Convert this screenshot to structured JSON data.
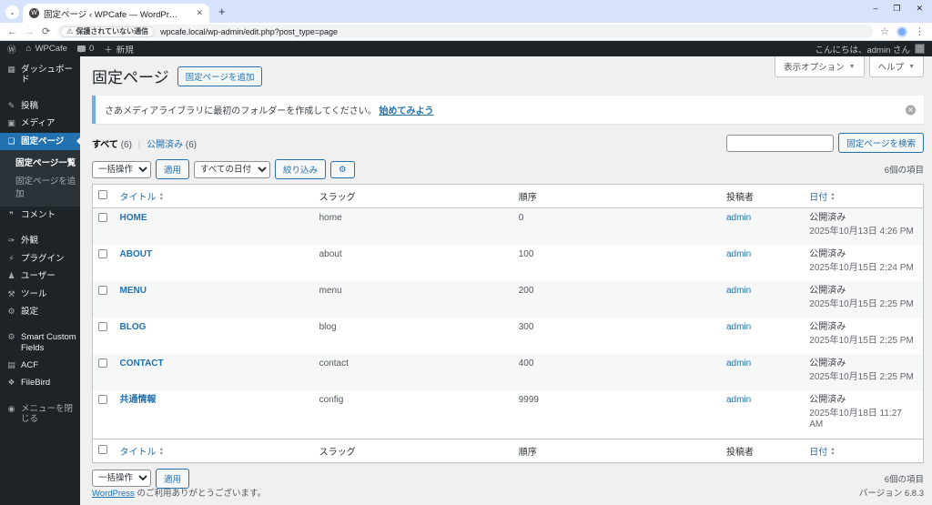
{
  "colors": {
    "accent": "#2271b1",
    "sidebar_bg": "#1d2327",
    "notice_border": "#72aee6",
    "titlebar_bg": "#d7e3fc"
  },
  "browser": {
    "tab_title": "固定ページ ‹ WPCafe — WordPr…",
    "favicon_letter": "W",
    "tab_close": "✕",
    "new_tab": "+",
    "minimize": "–",
    "restore": "❐",
    "close_window": "✕",
    "back": "←",
    "forward": "→",
    "reload": "⟳",
    "security_label": "保護されていない通信",
    "warn_icon": "⚠",
    "url": "wpcafe.local/wp-admin/edit.php?post_type=page",
    "bookmark_star": "☆",
    "menu_dots": "⋮",
    "chevron": "⌄"
  },
  "admin_bar": {
    "wp_logo": "Ⓦ",
    "home_icon": "⌂",
    "site_name": "WPCafe",
    "comment_count": "0",
    "plus": "＋",
    "new_label": "新規",
    "greeting": "こんにちは、admin さん"
  },
  "sidebar": {
    "items": [
      {
        "label": "ダッシュボード",
        "icon": "▦"
      },
      {
        "label": "投稿",
        "icon": "✎"
      },
      {
        "label": "メディア",
        "icon": "▣"
      },
      {
        "label": "固定ページ",
        "icon": "❏"
      },
      {
        "label": "コメント",
        "icon": "❞"
      },
      {
        "label": "外観",
        "icon": "✑"
      },
      {
        "label": "プラグイン",
        "icon": "⚡"
      },
      {
        "label": "ユーザー",
        "icon": "♟"
      },
      {
        "label": "ツール",
        "icon": "⚒"
      },
      {
        "label": "設定",
        "icon": "⚙"
      },
      {
        "label": "Smart Custom Fields",
        "icon": "⚙"
      },
      {
        "label": "ACF",
        "icon": "▤"
      },
      {
        "label": "FileBird",
        "icon": "❖"
      },
      {
        "label": "メニューを閉じる",
        "icon": "◉"
      }
    ],
    "submenu": [
      {
        "label": "固定ページ一覧"
      },
      {
        "label": "固定ページを追加"
      }
    ]
  },
  "header": {
    "title": "固定ページ",
    "add_button": "固定ページを追加",
    "screen_options": "表示オプション",
    "help": "ヘルプ",
    "caret": "▼"
  },
  "notice": {
    "text": "さあメディアライブラリに最初のフォルダーを作成してください。",
    "link": "始めてみよう",
    "dismiss": "✕"
  },
  "filters": {
    "all": "すべて",
    "all_count": "(6)",
    "published": "公開済み",
    "published_count": "(6)",
    "search_button": "固定ページを検索"
  },
  "bulk": {
    "bulk_action": "一括操作",
    "apply": "適用",
    "all_dates": "すべての日付",
    "filter": "絞り込み",
    "gear": "⚙",
    "items_count": "6個の項目"
  },
  "table": {
    "headers": {
      "title": "タイトル",
      "slug": "スラッグ",
      "order": "順序",
      "author": "投稿者",
      "date": "日付"
    },
    "rows": [
      {
        "title": "HOME",
        "slug": "home",
        "order": "0",
        "author": "admin",
        "status": "公開済み",
        "date": "2025年10月13日 4:26 PM"
      },
      {
        "title": "ABOUT",
        "slug": "about",
        "order": "100",
        "author": "admin",
        "status": "公開済み",
        "date": "2025年10月15日 2:24 PM"
      },
      {
        "title": "MENU",
        "slug": "menu",
        "order": "200",
        "author": "admin",
        "status": "公開済み",
        "date": "2025年10月15日 2:25 PM"
      },
      {
        "title": "BLOG",
        "slug": "blog",
        "order": "300",
        "author": "admin",
        "status": "公開済み",
        "date": "2025年10月15日 2:25 PM"
      },
      {
        "title": "CONTACT",
        "slug": "contact",
        "order": "400",
        "author": "admin",
        "status": "公開済み",
        "date": "2025年10月15日 2:25 PM"
      },
      {
        "title": "共通情報",
        "slug": "config",
        "order": "9999",
        "author": "admin",
        "status": "公開済み",
        "date": "2025年10月18日 11:27 AM"
      }
    ]
  },
  "footer": {
    "thanks_link": "WordPress",
    "thanks_rest": " のご利用ありがとうございます。",
    "version": "バージョン 6.8.3"
  }
}
